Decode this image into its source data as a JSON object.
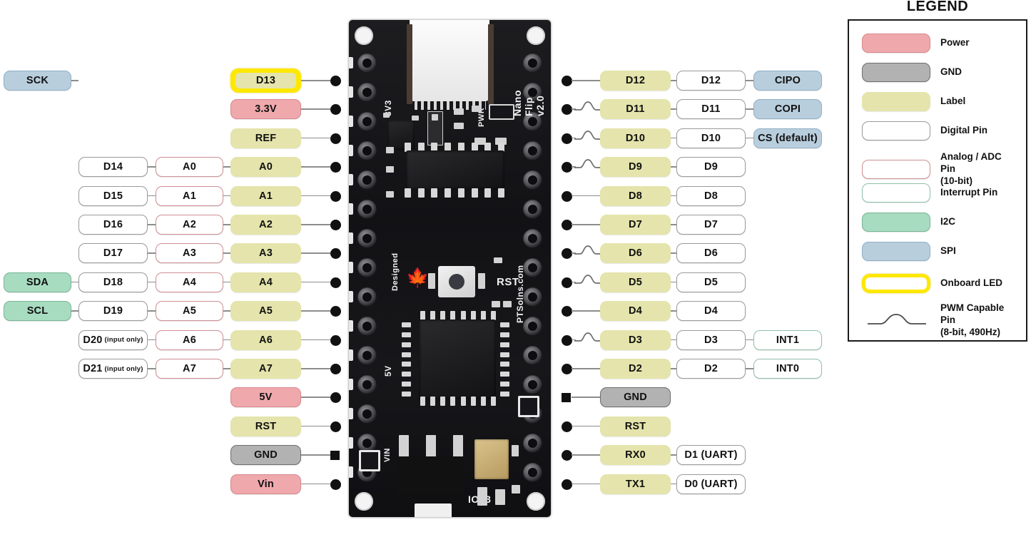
{
  "legend": {
    "title": "LEGEND",
    "items": [
      {
        "label": "Power",
        "kind": "power"
      },
      {
        "label": "GND",
        "kind": "gnd"
      },
      {
        "label": "Label",
        "kind": "label"
      },
      {
        "label": "Digital Pin",
        "kind": "digital"
      },
      {
        "label": "Analog / ADC Pin\n(10-bit)",
        "kind": "analog"
      },
      {
        "label": "Interrupt Pin",
        "kind": "interrupt"
      },
      {
        "label": "I2C",
        "kind": "i2c"
      },
      {
        "label": "SPI",
        "kind": "spi"
      },
      {
        "label": "Onboard LED",
        "kind": "led"
      },
      {
        "label": "PWM Capable Pin\n(8-bit, 490Hz)",
        "kind": "pwm"
      }
    ]
  },
  "board": {
    "silkscreen": {
      "title": "Nano Flip v2.0",
      "pwr": "PWR",
      "v3v3": "3V3",
      "v5v": "5V",
      "vin": "VIN",
      "rst": "RST",
      "designed": "Designed",
      "brand": "PTSolns.com",
      "io13": "IO13"
    }
  },
  "left_rows": [
    {
      "pad": "dot",
      "label": "D13",
      "label_kind": "led",
      "digital": null,
      "alt": null,
      "extra": {
        "text": "SCK",
        "kind": "spi"
      },
      "pwm": false
    },
    {
      "pad": "dot",
      "label": "3.3V",
      "label_kind": "power",
      "digital": null,
      "alt": null,
      "extra": null,
      "pwm": false
    },
    {
      "pad": "dot",
      "label": "REF",
      "label_kind": "label",
      "digital": null,
      "alt": null,
      "extra": null,
      "pwm": false
    },
    {
      "pad": "dot",
      "label": "A0",
      "label_kind": "label",
      "digital": {
        "text": "D14",
        "sub": null
      },
      "alt": {
        "text": "A0",
        "kind": "analog"
      },
      "extra": null,
      "pwm": false
    },
    {
      "pad": "dot",
      "label": "A1",
      "label_kind": "label",
      "digital": {
        "text": "D15",
        "sub": null
      },
      "alt": {
        "text": "A1",
        "kind": "analog"
      },
      "extra": null,
      "pwm": false
    },
    {
      "pad": "dot",
      "label": "A2",
      "label_kind": "label",
      "digital": {
        "text": "D16",
        "sub": null
      },
      "alt": {
        "text": "A2",
        "kind": "analog"
      },
      "extra": null,
      "pwm": false
    },
    {
      "pad": "dot",
      "label": "A3",
      "label_kind": "label",
      "digital": {
        "text": "D17",
        "sub": null
      },
      "alt": {
        "text": "A3",
        "kind": "analog"
      },
      "extra": null,
      "pwm": false
    },
    {
      "pad": "dot",
      "label": "A4",
      "label_kind": "label",
      "digital": {
        "text": "D18",
        "sub": null
      },
      "alt": {
        "text": "A4",
        "kind": "analog"
      },
      "extra": {
        "text": "SDA",
        "kind": "i2c"
      },
      "pwm": false
    },
    {
      "pad": "dot",
      "label": "A5",
      "label_kind": "label",
      "digital": {
        "text": "D19",
        "sub": null
      },
      "alt": {
        "text": "A5",
        "kind": "analog"
      },
      "extra": {
        "text": "SCL",
        "kind": "i2c"
      },
      "pwm": false
    },
    {
      "pad": "dot",
      "label": "A6",
      "label_kind": "label",
      "digital": {
        "text": "D20",
        "sub": "(input only)"
      },
      "alt": {
        "text": "A6",
        "kind": "analog"
      },
      "extra": null,
      "pwm": false
    },
    {
      "pad": "dot",
      "label": "A7",
      "label_kind": "label",
      "digital": {
        "text": "D21",
        "sub": "(input only)"
      },
      "alt": {
        "text": "A7",
        "kind": "analog"
      },
      "extra": null,
      "pwm": false
    },
    {
      "pad": "dot",
      "label": "5V",
      "label_kind": "power",
      "digital": null,
      "alt": null,
      "extra": null,
      "pwm": false
    },
    {
      "pad": "dot",
      "label": "RST",
      "label_kind": "label",
      "digital": null,
      "alt": null,
      "extra": null,
      "pwm": false
    },
    {
      "pad": "square",
      "label": "GND",
      "label_kind": "gnd",
      "digital": null,
      "alt": null,
      "extra": null,
      "pwm": false
    },
    {
      "pad": "dot",
      "label": "Vin",
      "label_kind": "power",
      "digital": null,
      "alt": null,
      "extra": null,
      "pwm": false
    }
  ],
  "right_rows": [
    {
      "pad": "dot",
      "label": "D12",
      "label_kind": "label",
      "digital": {
        "text": "D12",
        "kind": "digital"
      },
      "extra": {
        "text": "CIPO",
        "kind": "spi"
      },
      "pwm": false
    },
    {
      "pad": "dot",
      "label": "D11",
      "label_kind": "label",
      "digital": {
        "text": "D11",
        "kind": "digital"
      },
      "extra": {
        "text": "COPI",
        "kind": "spi"
      },
      "pwm": true
    },
    {
      "pad": "dot",
      "label": "D10",
      "label_kind": "label",
      "digital": {
        "text": "D10",
        "kind": "digital"
      },
      "extra": {
        "text": "CS (default)",
        "kind": "spi"
      },
      "pwm": true
    },
    {
      "pad": "dot",
      "label": "D9",
      "label_kind": "label",
      "digital": {
        "text": "D9",
        "kind": "digital"
      },
      "extra": null,
      "pwm": true
    },
    {
      "pad": "dot",
      "label": "D8",
      "label_kind": "label",
      "digital": {
        "text": "D8",
        "kind": "digital"
      },
      "extra": null,
      "pwm": false
    },
    {
      "pad": "dot",
      "label": "D7",
      "label_kind": "label",
      "digital": {
        "text": "D7",
        "kind": "digital"
      },
      "extra": null,
      "pwm": false
    },
    {
      "pad": "dot",
      "label": "D6",
      "label_kind": "label",
      "digital": {
        "text": "D6",
        "kind": "digital"
      },
      "extra": null,
      "pwm": true
    },
    {
      "pad": "dot",
      "label": "D5",
      "label_kind": "label",
      "digital": {
        "text": "D5",
        "kind": "digital"
      },
      "extra": null,
      "pwm": true
    },
    {
      "pad": "dot",
      "label": "D4",
      "label_kind": "label",
      "digital": {
        "text": "D4",
        "kind": "digital"
      },
      "extra": null,
      "pwm": false
    },
    {
      "pad": "dot",
      "label": "D3",
      "label_kind": "label",
      "digital": {
        "text": "D3",
        "kind": "digital"
      },
      "extra": {
        "text": "INT1",
        "kind": "interrupt"
      },
      "pwm": true
    },
    {
      "pad": "dot",
      "label": "D2",
      "label_kind": "label",
      "digital": {
        "text": "D2",
        "kind": "digital"
      },
      "extra": {
        "text": "INT0",
        "kind": "interrupt"
      },
      "pwm": false
    },
    {
      "pad": "square",
      "label": "GND",
      "label_kind": "gnd",
      "digital": null,
      "extra": null,
      "pwm": false
    },
    {
      "pad": "dot",
      "label": "RST",
      "label_kind": "label",
      "digital": null,
      "extra": null,
      "pwm": false
    },
    {
      "pad": "dot",
      "label": "RX0",
      "label_kind": "label",
      "digital": {
        "text": "D1 (UART)",
        "kind": "digital"
      },
      "extra": null,
      "pwm": false
    },
    {
      "pad": "dot",
      "label": "TX1",
      "label_kind": "label",
      "digital": {
        "text": "D0 (UART)",
        "kind": "digital"
      },
      "extra": null,
      "pwm": false
    }
  ]
}
